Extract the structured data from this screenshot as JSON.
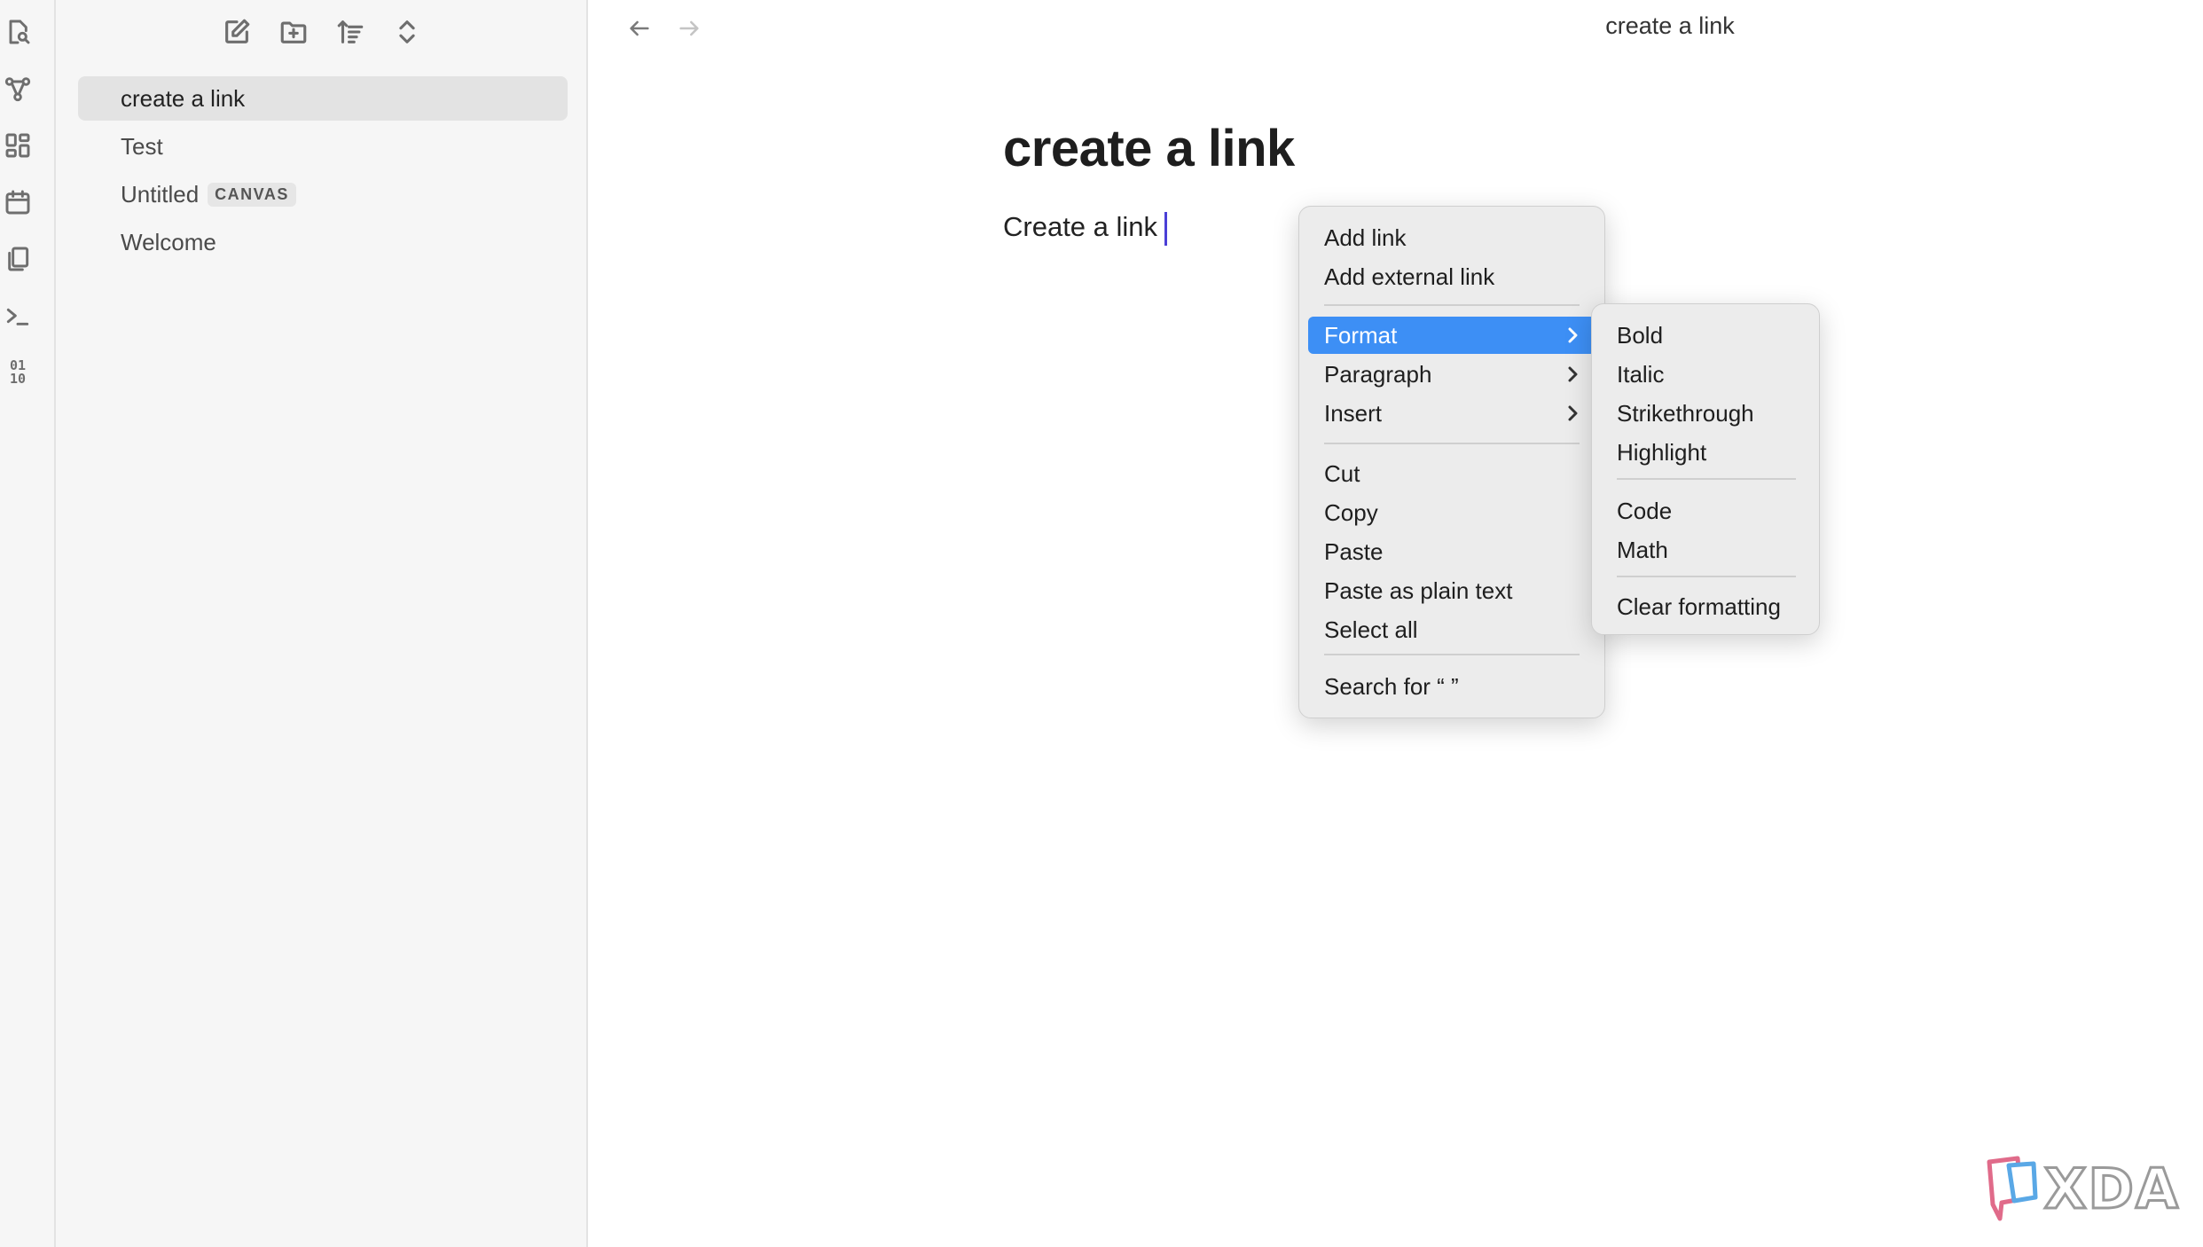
{
  "ribbon": {
    "icons": [
      "search-file-icon",
      "graph-icon",
      "dashboard-icon",
      "calendar-icon",
      "copy-icon",
      "terminal-icon",
      "binary-icon"
    ],
    "binary_top": "01",
    "binary_bottom": "10"
  },
  "sidebar": {
    "toolbar": [
      "new-note-icon",
      "new-folder-icon",
      "sort-icon",
      "collapse-icon"
    ],
    "files": [
      {
        "label": "create a link",
        "active": true
      },
      {
        "label": "Test"
      },
      {
        "label": "Untitled",
        "tag": "CANVAS"
      },
      {
        "label": "Welcome"
      }
    ]
  },
  "main": {
    "view_title": "create a link",
    "note_title": "create a link",
    "note_body": "Create a link"
  },
  "context_menu": {
    "items": [
      {
        "label": "Add link"
      },
      {
        "label": "Add external link"
      },
      {
        "label": "Format",
        "submenu": true,
        "highlighted": true
      },
      {
        "label": "Paragraph",
        "submenu": true
      },
      {
        "label": "Insert",
        "submenu": true
      },
      {
        "label": "Cut"
      },
      {
        "label": "Copy"
      },
      {
        "label": "Paste"
      },
      {
        "label": "Paste as plain text"
      },
      {
        "label": "Select all"
      },
      {
        "label": "Search for “ ”"
      }
    ]
  },
  "format_submenu": {
    "items": [
      {
        "label": "Bold"
      },
      {
        "label": "Italic"
      },
      {
        "label": "Strikethrough"
      },
      {
        "label": "Highlight"
      },
      {
        "label": "Code"
      },
      {
        "label": "Math"
      },
      {
        "label": "Clear formatting"
      }
    ]
  },
  "watermark": {
    "text": "XDA"
  },
  "colors": {
    "highlight": "#3d8ff5",
    "caret": "#4a3fd6",
    "sidebar_bg": "#f6f6f6"
  }
}
